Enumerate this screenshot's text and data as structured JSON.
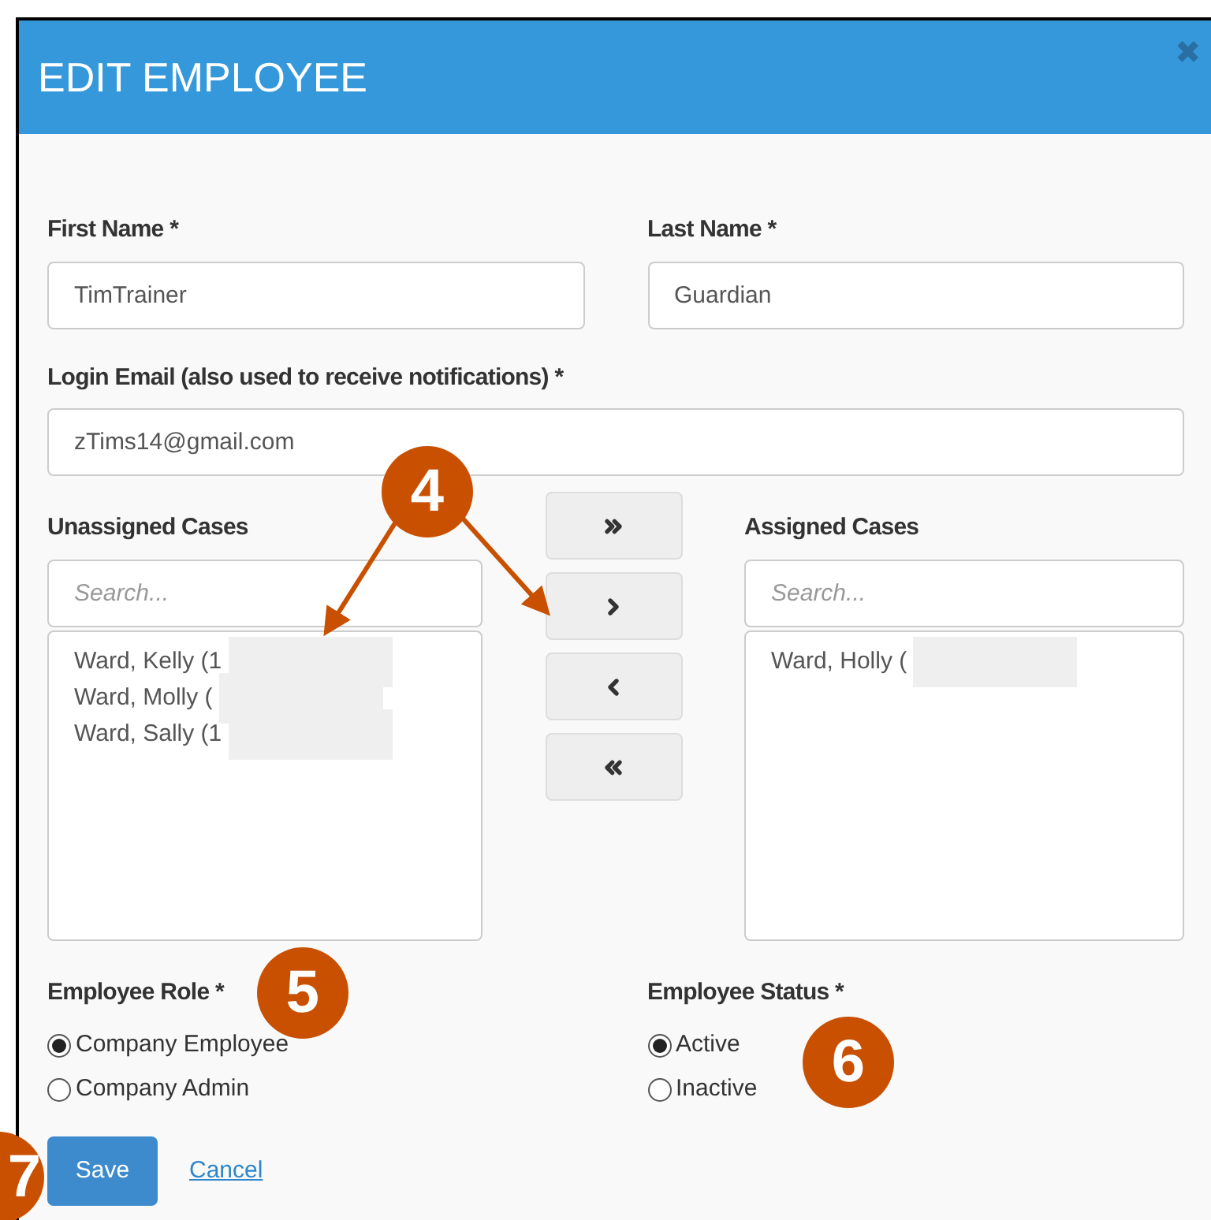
{
  "dialog": {
    "title": "EDIT EMPLOYEE",
    "close": "✖"
  },
  "first_name": {
    "label": "First Name",
    "required": "*",
    "value": "TimTrainer"
  },
  "last_name": {
    "label": "Last Name",
    "required": "*",
    "value": "Guardian"
  },
  "email": {
    "label": "Login Email (also used to receive notifications)",
    "required": "*",
    "value": "zTims14@gmail.com"
  },
  "unassigned": {
    "label": "Unassigned Cases",
    "placeholder": "Search...",
    "items": [
      "Ward, Kelly (1",
      "Ward, Molly (",
      "Ward, Sally (1"
    ]
  },
  "move_buttons": [
    {
      "kind": "all-right"
    },
    {
      "kind": "right"
    },
    {
      "kind": "left"
    },
    {
      "kind": "all-left"
    }
  ],
  "assigned": {
    "label": "Assigned Cases",
    "placeholder": "Search...",
    "items": [
      "Ward, Holly ("
    ]
  },
  "role": {
    "label": "Employee Role",
    "required": "*",
    "options": [
      {
        "label": "Company Employee",
        "selected": true
      },
      {
        "label": "Company Admin",
        "selected": false
      }
    ]
  },
  "status": {
    "label": "Employee Status",
    "required": "*",
    "options": [
      {
        "label": "Active",
        "selected": true
      },
      {
        "label": "Inactive",
        "selected": false
      }
    ]
  },
  "actions": {
    "save": "Save",
    "cancel": "Cancel"
  },
  "callouts": [
    {
      "label": "4"
    },
    {
      "label": "5"
    },
    {
      "label": "6"
    },
    {
      "label": "7"
    }
  ]
}
